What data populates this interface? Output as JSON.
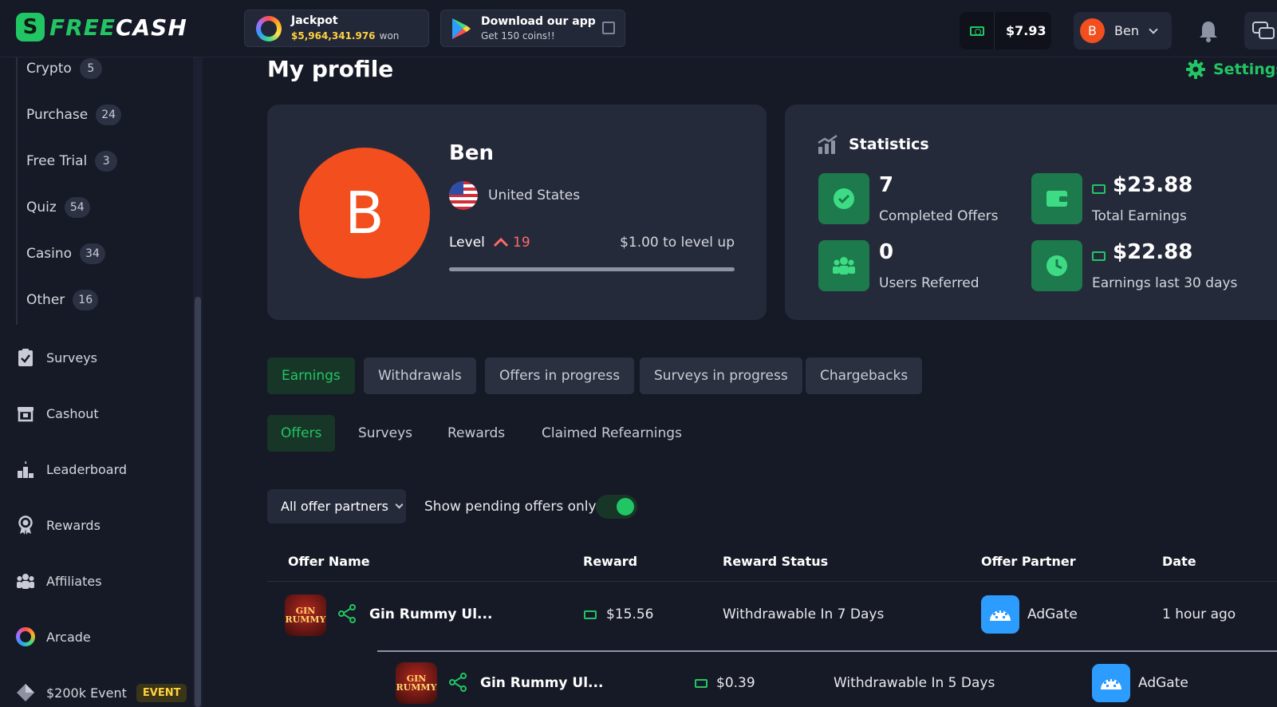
{
  "brand": {
    "logo_letter": "S",
    "name_prefix": "FREE",
    "name_suffix": "CASH"
  },
  "header": {
    "jackpot_title": "Jackpot",
    "jackpot_amount": "$5,964,341.976",
    "jackpot_suffix": "won",
    "app_title": "Download our app",
    "app_subtitle": "Get 150 coins!!",
    "balance": "$7.93",
    "user_initial": "B",
    "user_name": "Ben"
  },
  "sidebar": {
    "categories": [
      {
        "label": "Crypto",
        "count": "5"
      },
      {
        "label": "Purchase",
        "count": "24"
      },
      {
        "label": "Free Trial",
        "count": "3"
      },
      {
        "label": "Quiz",
        "count": "54"
      },
      {
        "label": "Casino",
        "count": "34"
      },
      {
        "label": "Other",
        "count": "16"
      }
    ],
    "nav": [
      {
        "label": "Surveys",
        "icon": "clipboard-check-icon"
      },
      {
        "label": "Cashout",
        "icon": "cashout-icon"
      },
      {
        "label": "Leaderboard",
        "icon": "podium-icon"
      },
      {
        "label": "Rewards",
        "icon": "medal-icon"
      },
      {
        "label": "Affiliates",
        "icon": "users-icon"
      },
      {
        "label": "Arcade",
        "icon": "arcade-ring-icon"
      },
      {
        "label": "$200k Event",
        "icon": "diamond-icon",
        "badge": "EVENT"
      }
    ]
  },
  "main": {
    "title": "My profile",
    "settings_label": "Settings",
    "profile": {
      "initial": "B",
      "name": "Ben",
      "country": "United States",
      "level_label": "Level",
      "level": "19",
      "level_up_text": "$1.00 to level up",
      "level_progress": 1.0
    },
    "statistics": {
      "title": "Statistics",
      "completed_offers": "7",
      "completed_offers_label": "Completed Offers",
      "total_earnings": "$23.88",
      "total_earnings_label": "Total Earnings",
      "users_referred": "0",
      "users_referred_label": "Users Referred",
      "earnings_30d": "$22.88",
      "earnings_30d_label": "Earnings last 30 days"
    },
    "tabs": [
      "Earnings",
      "Withdrawals",
      "Offers in progress",
      "Surveys in progress",
      "Chargebacks"
    ],
    "subtabs": [
      "Offers",
      "Surveys",
      "Rewards",
      "Claimed Refearnings"
    ],
    "filter": {
      "partners_label": "All offer partners",
      "pending_label": "Show pending offers only",
      "pending_on": true
    },
    "table": {
      "headers": [
        "Offer Name",
        "Reward",
        "Reward Status",
        "Offer Partner",
        "Date"
      ],
      "rows": [
        {
          "thumb_text": "GIN RUMMY",
          "name": "Gin Rummy Ul...",
          "reward": "$15.56",
          "status": "Withdrawable In 7 Days",
          "partner": "AdGate",
          "date": "1 hour ago"
        },
        {
          "thumb_text": "GIN RUMMY",
          "name": "Gin Rummy Ul...",
          "reward": "$0.39",
          "status": "Withdrawable In 5 Days",
          "partner": "AdGate",
          "date": ""
        }
      ]
    }
  },
  "colors": {
    "accent": "#22c564",
    "background": "#161a26",
    "card": "#252a3a",
    "avatar": "#f24e1e",
    "jackpot": "#ffd23f"
  }
}
